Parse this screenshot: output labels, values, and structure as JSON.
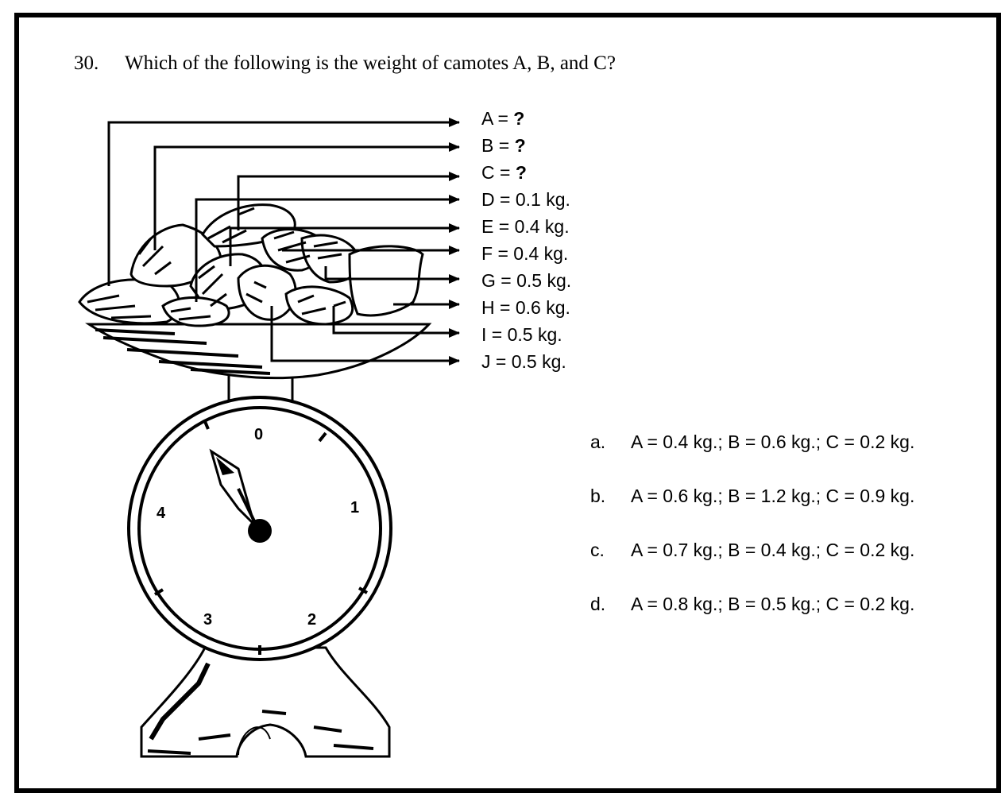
{
  "question": {
    "number": "30.",
    "text": "Which of the following is the weight of camotes A, B, and C?"
  },
  "camote_labels": [
    {
      "name": "A",
      "weight": "?"
    },
    {
      "name": "B",
      "weight": "?"
    },
    {
      "name": "C",
      "weight": "?"
    },
    {
      "name": "D",
      "weight": "0.1 kg."
    },
    {
      "name": "E",
      "weight": "0.4 kg."
    },
    {
      "name": "F",
      "weight": "0.4 kg."
    },
    {
      "name": "G",
      "weight": "0.5 kg."
    },
    {
      "name": "H",
      "weight": "0.6 kg."
    },
    {
      "name": "I",
      "weight": "0.5 kg."
    },
    {
      "name": "J",
      "weight": "0.5 kg."
    }
  ],
  "scale_dial": {
    "numbers": [
      "0",
      "1",
      "2",
      "3",
      "4"
    ]
  },
  "choices": [
    {
      "letter": "a.",
      "text": "A = 0.4 kg.; B = 0.6 kg.; C = 0.2 kg."
    },
    {
      "letter": "b.",
      "text": "A = 0.6 kg.; B = 1.2 kg.; C = 0.9 kg."
    },
    {
      "letter": "c.",
      "text": "A = 0.7 kg.; B = 0.4 kg.; C = 0.2 kg."
    },
    {
      "letter": "d.",
      "text": "A = 0.8 kg.; B = 0.5 kg.; C = 0.2 kg."
    }
  ]
}
